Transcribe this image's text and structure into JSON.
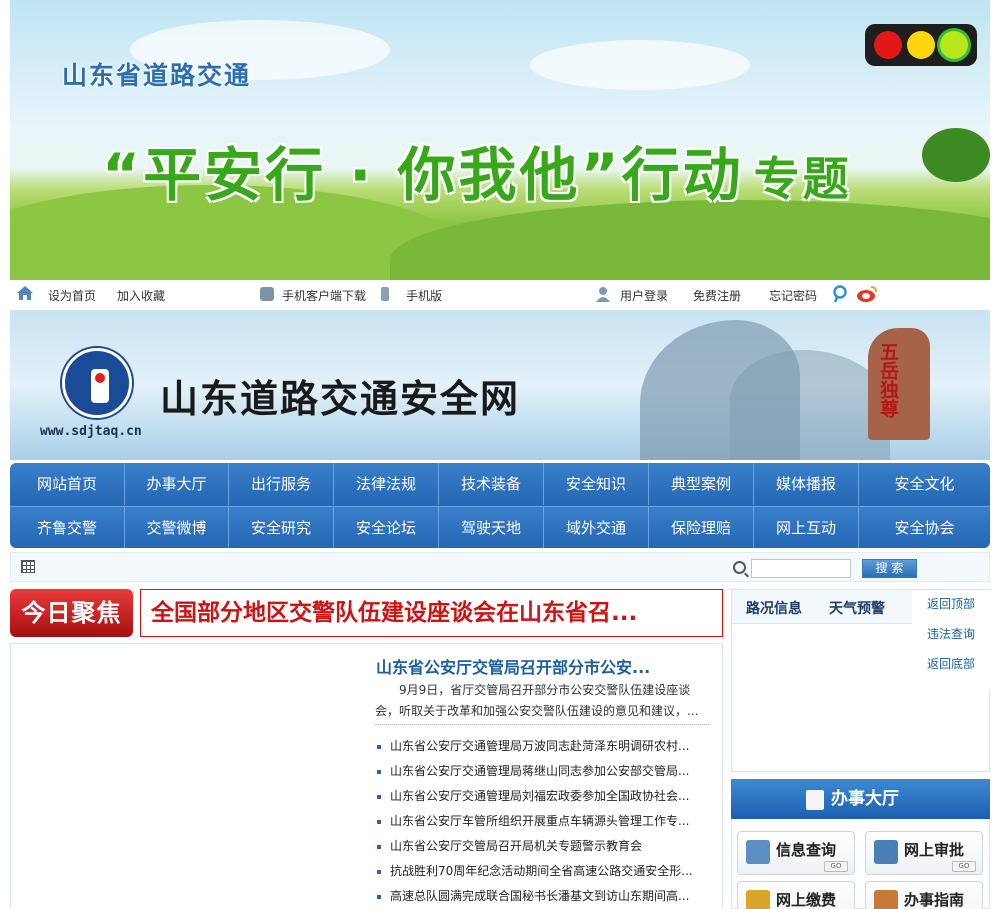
{
  "banner": {
    "subtitle": "山东省道路交通",
    "title": "“平安行 · 你我他”行动",
    "title_suffix": "专题"
  },
  "topbar": {
    "set_home": "设为首页",
    "add_favorite": "加入收藏",
    "app_download": "手机客户端下载",
    "mobile_version": "手机版",
    "user_login": "用户登录",
    "free_register": "免费注册",
    "forgot_password": "忘记密码"
  },
  "header": {
    "site_name": "山东道路交通安全网",
    "url": "www.sdjtaq.cn",
    "rock_text": "五岳独尊"
  },
  "nav": {
    "row1": [
      "网站首页",
      "办事大厅",
      "出行服务",
      "法律法规",
      "技术装备",
      "安全知识",
      "典型案例",
      "媒体播报",
      "安全文化"
    ],
    "row2": [
      "齐鲁交警",
      "交警微博",
      "安全研究",
      "安全论坛",
      "驾驶天地",
      "域外交通",
      "保险理赔",
      "网上互动",
      "安全协会"
    ]
  },
  "search": {
    "placeholder": "",
    "button": "搜 索"
  },
  "focus": {
    "badge": "今日聚焦",
    "headline": "全国部分地区交警队伍建设座谈会在山东省召..."
  },
  "news": {
    "headline": "山东省公安厅交管局召开部分市公安...",
    "summary": "9月9日，省厅交管局召开部分市公安交警队伍建设座谈会，听取关于改革和加强公安交警队伍建设的意见和建议，...",
    "items": [
      "山东省公安厅交通管理局万波同志赴菏泽东明调研农村...",
      "山东省公安厅交通管理局蒋继山同志参加公安部交管局...",
      "山东省公安厅交通管理局刘福宏政委参加全国政协社会...",
      "山东省公安厅车管所组织开展重点车辆源头管理工作专...",
      "山东省公安厅交管局召开局机关专题警示教育会",
      "抗战胜利70周年纪念活动期间全省高速公路交通安全形...",
      "高速总队圆满完成联合国秘书长潘基文到访山东期间高..."
    ]
  },
  "right": {
    "tab_road": "路况信息",
    "tab_weather": "天气预警",
    "back_top": "返回顶部",
    "violation_query": "违法查询",
    "back_bottom": "返回底部",
    "hall_title": "办事大厅",
    "tiles": [
      "信息查询",
      "网上审批",
      "网上缴费",
      "办事指南"
    ],
    "go": "GO"
  }
}
